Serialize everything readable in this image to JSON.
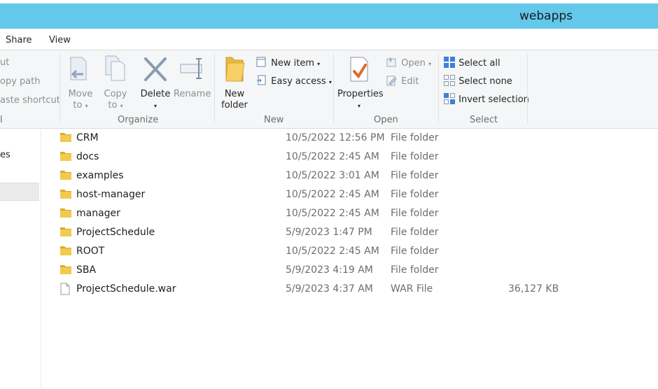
{
  "window": {
    "title": "webapps"
  },
  "tabs": [
    {
      "label": "Share"
    },
    {
      "label": "View"
    }
  ],
  "ribbon": {
    "clipboard": {
      "cut": "ut",
      "copy_path": "opy path",
      "paste_shortcut": "aste shortcut",
      "group_label": "l"
    },
    "organize": {
      "group_label": "Organize",
      "move_to": {
        "line1": "Move",
        "line2": "to"
      },
      "copy_to": {
        "line1": "Copy",
        "line2": "to"
      },
      "delete": "Delete",
      "rename": "Rename"
    },
    "new": {
      "group_label": "New",
      "new_folder": {
        "line1": "New",
        "line2": "folder"
      },
      "new_item": "New item",
      "easy_access": "Easy access"
    },
    "open": {
      "group_label": "Open",
      "properties": "Properties",
      "open": "Open",
      "edit": "Edit"
    },
    "select": {
      "group_label": "Select",
      "select_all": "Select all",
      "select_none": "Select none",
      "invert_selection": "Invert selection"
    }
  },
  "nav_pane": {
    "partial_item": "es"
  },
  "files": [
    {
      "name": "CRM",
      "date": "10/5/2022 12:56 PM",
      "type": "File folder",
      "size": "",
      "icon": "folder-icon"
    },
    {
      "name": "docs",
      "date": "10/5/2022 2:45 AM",
      "type": "File folder",
      "size": "",
      "icon": "folder-icon"
    },
    {
      "name": "examples",
      "date": "10/5/2022 3:01 AM",
      "type": "File folder",
      "size": "",
      "icon": "folder-icon"
    },
    {
      "name": "host-manager",
      "date": "10/5/2022 2:45 AM",
      "type": "File folder",
      "size": "",
      "icon": "folder-icon"
    },
    {
      "name": "manager",
      "date": "10/5/2022 2:45 AM",
      "type": "File folder",
      "size": "",
      "icon": "folder-icon"
    },
    {
      "name": "ProjectSchedule",
      "date": "5/9/2023 1:47 PM",
      "type": "File folder",
      "size": "",
      "icon": "folder-icon"
    },
    {
      "name": "ROOT",
      "date": "10/5/2022 2:45 AM",
      "type": "File folder",
      "size": "",
      "icon": "folder-icon"
    },
    {
      "name": "SBA",
      "date": "5/9/2023 4:19 AM",
      "type": "File folder",
      "size": "",
      "icon": "folder-icon"
    },
    {
      "name": "ProjectSchedule.war",
      "date": "5/9/2023 4:37 AM",
      "type": "WAR File",
      "size": "36,127 KB",
      "icon": "file-icon"
    }
  ],
  "colors": {
    "titlebar": "#63c8ea",
    "folder": "#f2c94c",
    "accent": "#2b79d6"
  }
}
